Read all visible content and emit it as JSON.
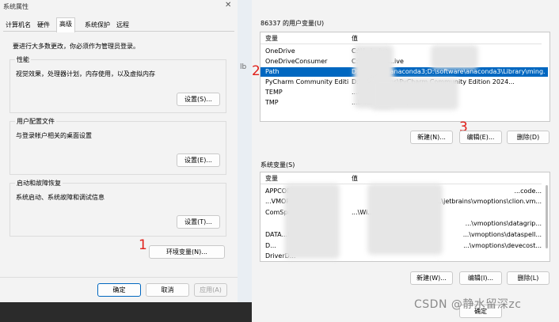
{
  "left": {
    "title": "系统属性",
    "tabs": [
      "计算机名",
      "硬件",
      "高级",
      "系统保护",
      "远程"
    ],
    "active_tab": 2,
    "notice": "要进行大多数更改，你必须作为管理员登录。",
    "performance": {
      "title": "性能",
      "desc": "视觉效果，处理器计划，内存使用，以及虚拟内存",
      "button": "设置(S)..."
    },
    "profile": {
      "title": "用户配置文件",
      "desc": "与登录帐户相关的桌面设置",
      "button": "设置(E)..."
    },
    "startup": {
      "title": "启动和故障恢复",
      "desc": "系统启动、系统故障和调试信息",
      "button": "设置(T)..."
    },
    "env_button": "环境变量(N)...",
    "ok": "确定",
    "cancel": "取消",
    "apply": "应用(A)"
  },
  "right": {
    "user_vars_title": "86337 的用户变量(U)",
    "col_var": "变量",
    "col_val": "值",
    "user_vars": [
      {
        "name": "OneDrive",
        "value": "C:\\U...\\...ive"
      },
      {
        "name": "OneDriveConsumer",
        "value": "C:\\Users\\...\\...ive"
      },
      {
        "name": "Path",
        "value": "D:\\software\\anaconda3;D:\\software\\anaconda3\\Library\\ming..."
      },
      {
        "name": "PyCharm Community Editi...",
        "value": "D:\\...\\JetBrains\\PyCharm Community Edition 2024..."
      },
      {
        "name": "TEMP",
        "value": "...ata\\Local\\Temp"
      },
      {
        "name": "TMP",
        "value": "...Data\\Local\\Temp"
      }
    ],
    "selected_index": 2,
    "user_buttons": {
      "new": "新建(N)...",
      "edit": "编辑(E)...",
      "delete": "删除(D)"
    },
    "sys_vars_title": "系统变量(S)",
    "sys_vars": [
      {
        "name": "APPCODE...",
        "value": "...code..."
      },
      {
        "name": "...VMOPTIONS",
        "value": "...\\jetbrains\\vmoptions\\clion.vm..."
      },
      {
        "name": "ComSpec...IONS",
        "value": "...\\Wi..."
      },
      {
        "name": "",
        "value": "...\\vmoptions\\datagrip..."
      },
      {
        "name": "DATA...IONS",
        "value": "...\\vmoptions\\dataspell..."
      },
      {
        "name": "D...",
        "value": "...\\vmoptions\\devecost..."
      },
      {
        "name": "DriverD...",
        "value": ""
      }
    ],
    "sys_buttons": {
      "new": "新建(W)...",
      "edit": "编辑(I)...",
      "delete": "删除(L)"
    },
    "bottom_button": "确定"
  },
  "annotations": [
    "1",
    "2",
    "3"
  ],
  "watermark": "CSDN @静水留深zc",
  "bg_fragment": "lb"
}
